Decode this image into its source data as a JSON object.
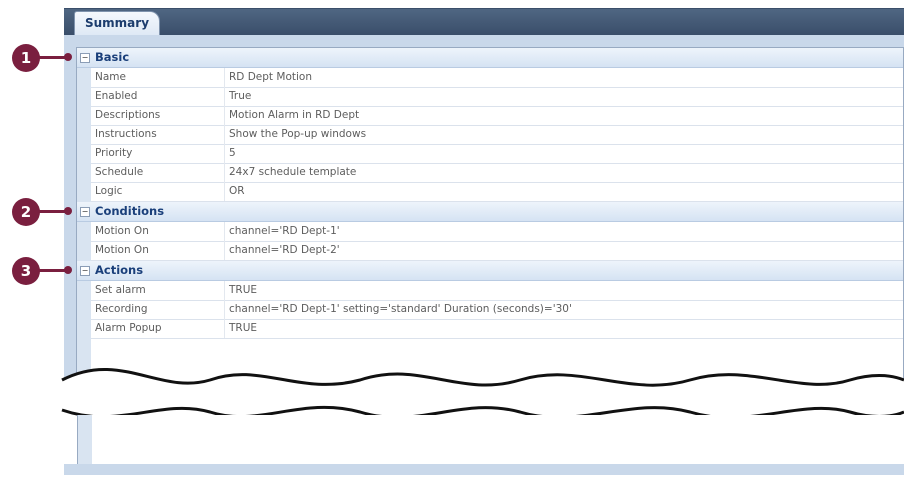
{
  "tab": {
    "label": "Summary"
  },
  "sections": [
    {
      "label": "Basic",
      "toggle": "−",
      "callout": "1",
      "rows": [
        {
          "key": "Name",
          "value": "RD Dept Motion"
        },
        {
          "key": "Enabled",
          "value": "True"
        },
        {
          "key": "Descriptions",
          "value": "Motion Alarm in RD Dept"
        },
        {
          "key": "Instructions",
          "value": "Show the Pop-up windows"
        },
        {
          "key": "Priority",
          "value": "5"
        },
        {
          "key": "Schedule",
          "value": "24x7 schedule template"
        },
        {
          "key": "Logic",
          "value": "OR"
        }
      ]
    },
    {
      "label": "Conditions",
      "toggle": "−",
      "callout": "2",
      "rows": [
        {
          "key": "Motion On",
          "value": "channel='RD Dept-1'"
        },
        {
          "key": "Motion On",
          "value": "channel='RD Dept-2'"
        }
      ]
    },
    {
      "label": "Actions",
      "toggle": "−",
      "callout": "3",
      "rows": [
        {
          "key": "Set alarm",
          "value": "TRUE"
        },
        {
          "key": "Recording",
          "value": "channel='RD Dept-1' setting='standard' Duration (seconds)='30'"
        },
        {
          "key": "Alarm Popup",
          "value": "TRUE"
        }
      ]
    }
  ],
  "colors": {
    "callout": "#7a1f3f",
    "category_text": "#1a3f7a",
    "tab_bar": "#3a4e6a",
    "panel_bg": "#c9d8ea"
  }
}
